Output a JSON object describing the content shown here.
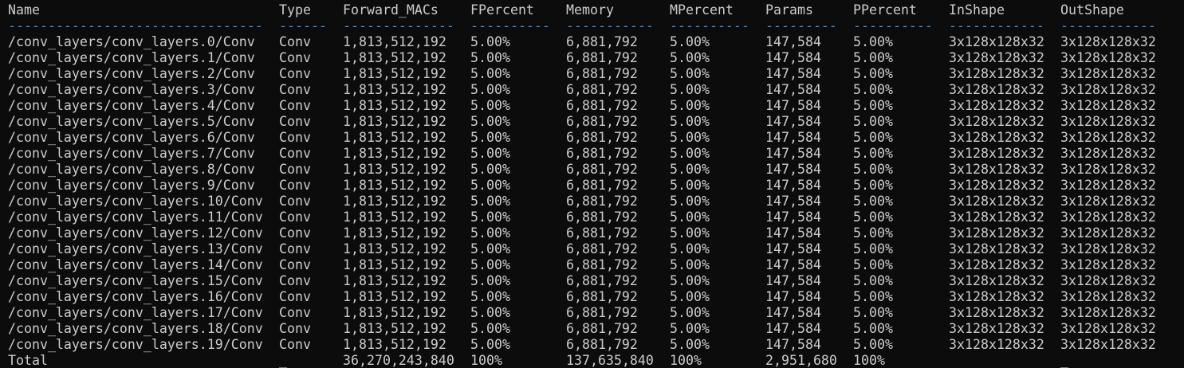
{
  "terminal": {
    "background": "#0c0c0c",
    "foreground": "#cccccc",
    "separator_color": "#3b8eea",
    "headers": [
      "Name",
      "Type",
      "Forward_MACs",
      "FPercent",
      "Memory",
      "MPercent",
      "Params",
      "PPercent",
      "InShape",
      "OutShape"
    ],
    "separators": [
      "--------------------------------",
      "------",
      "--------------",
      "----------",
      "-----------",
      "----------",
      "---------",
      "----------",
      "------------",
      "------------"
    ],
    "rows": [
      [
        "/conv_layers/conv_layers.0/Conv",
        "Conv",
        "1,813,512,192",
        "5.00%",
        "6,881,792",
        "5.00%",
        "147,584",
        "5.00%",
        "3x128x128x32",
        "3x128x128x32"
      ],
      [
        "/conv_layers/conv_layers.1/Conv",
        "Conv",
        "1,813,512,192",
        "5.00%",
        "6,881,792",
        "5.00%",
        "147,584",
        "5.00%",
        "3x128x128x32",
        "3x128x128x32"
      ],
      [
        "/conv_layers/conv_layers.2/Conv",
        "Conv",
        "1,813,512,192",
        "5.00%",
        "6,881,792",
        "5.00%",
        "147,584",
        "5.00%",
        "3x128x128x32",
        "3x128x128x32"
      ],
      [
        "/conv_layers/conv_layers.3/Conv",
        "Conv",
        "1,813,512,192",
        "5.00%",
        "6,881,792",
        "5.00%",
        "147,584",
        "5.00%",
        "3x128x128x32",
        "3x128x128x32"
      ],
      [
        "/conv_layers/conv_layers.4/Conv",
        "Conv",
        "1,813,512,192",
        "5.00%",
        "6,881,792",
        "5.00%",
        "147,584",
        "5.00%",
        "3x128x128x32",
        "3x128x128x32"
      ],
      [
        "/conv_layers/conv_layers.5/Conv",
        "Conv",
        "1,813,512,192",
        "5.00%",
        "6,881,792",
        "5.00%",
        "147,584",
        "5.00%",
        "3x128x128x32",
        "3x128x128x32"
      ],
      [
        "/conv_layers/conv_layers.6/Conv",
        "Conv",
        "1,813,512,192",
        "5.00%",
        "6,881,792",
        "5.00%",
        "147,584",
        "5.00%",
        "3x128x128x32",
        "3x128x128x32"
      ],
      [
        "/conv_layers/conv_layers.7/Conv",
        "Conv",
        "1,813,512,192",
        "5.00%",
        "6,881,792",
        "5.00%",
        "147,584",
        "5.00%",
        "3x128x128x32",
        "3x128x128x32"
      ],
      [
        "/conv_layers/conv_layers.8/Conv",
        "Conv",
        "1,813,512,192",
        "5.00%",
        "6,881,792",
        "5.00%",
        "147,584",
        "5.00%",
        "3x128x128x32",
        "3x128x128x32"
      ],
      [
        "/conv_layers/conv_layers.9/Conv",
        "Conv",
        "1,813,512,192",
        "5.00%",
        "6,881,792",
        "5.00%",
        "147,584",
        "5.00%",
        "3x128x128x32",
        "3x128x128x32"
      ],
      [
        "/conv_layers/conv_layers.10/Conv",
        "Conv",
        "1,813,512,192",
        "5.00%",
        "6,881,792",
        "5.00%",
        "147,584",
        "5.00%",
        "3x128x128x32",
        "3x128x128x32"
      ],
      [
        "/conv_layers/conv_layers.11/Conv",
        "Conv",
        "1,813,512,192",
        "5.00%",
        "6,881,792",
        "5.00%",
        "147,584",
        "5.00%",
        "3x128x128x32",
        "3x128x128x32"
      ],
      [
        "/conv_layers/conv_layers.12/Conv",
        "Conv",
        "1,813,512,192",
        "5.00%",
        "6,881,792",
        "5.00%",
        "147,584",
        "5.00%",
        "3x128x128x32",
        "3x128x128x32"
      ],
      [
        "/conv_layers/conv_layers.13/Conv",
        "Conv",
        "1,813,512,192",
        "5.00%",
        "6,881,792",
        "5.00%",
        "147,584",
        "5.00%",
        "3x128x128x32",
        "3x128x128x32"
      ],
      [
        "/conv_layers/conv_layers.14/Conv",
        "Conv",
        "1,813,512,192",
        "5.00%",
        "6,881,792",
        "5.00%",
        "147,584",
        "5.00%",
        "3x128x128x32",
        "3x128x128x32"
      ],
      [
        "/conv_layers/conv_layers.15/Conv",
        "Conv",
        "1,813,512,192",
        "5.00%",
        "6,881,792",
        "5.00%",
        "147,584",
        "5.00%",
        "3x128x128x32",
        "3x128x128x32"
      ],
      [
        "/conv_layers/conv_layers.16/Conv",
        "Conv",
        "1,813,512,192",
        "5.00%",
        "6,881,792",
        "5.00%",
        "147,584",
        "5.00%",
        "3x128x128x32",
        "3x128x128x32"
      ],
      [
        "/conv_layers/conv_layers.17/Conv",
        "Conv",
        "1,813,512,192",
        "5.00%",
        "6,881,792",
        "5.00%",
        "147,584",
        "5.00%",
        "3x128x128x32",
        "3x128x128x32"
      ],
      [
        "/conv_layers/conv_layers.18/Conv",
        "Conv",
        "1,813,512,192",
        "5.00%",
        "6,881,792",
        "5.00%",
        "147,584",
        "5.00%",
        "3x128x128x32",
        "3x128x128x32"
      ],
      [
        "/conv_layers/conv_layers.19/Conv",
        "Conv",
        "1,813,512,192",
        "5.00%",
        "6,881,792",
        "5.00%",
        "147,584",
        "5.00%",
        "3x128x128x32",
        "3x128x128x32"
      ]
    ],
    "total": [
      "Total",
      "_",
      "36,270,243,840",
      "100%",
      "137,635,840",
      "100%",
      "2,951,680",
      "100%",
      "",
      "_"
    ]
  }
}
